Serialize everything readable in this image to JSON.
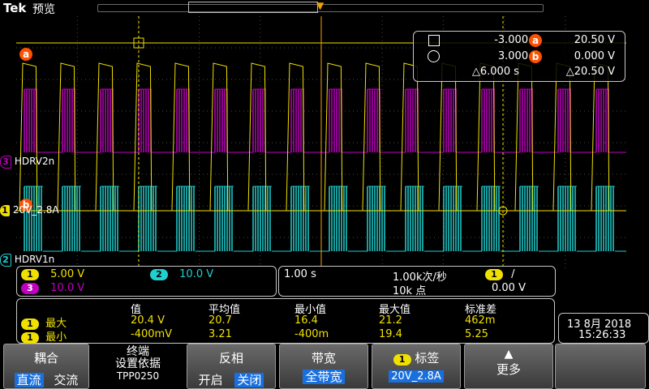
{
  "header": {
    "brand": "Tek",
    "mode": "预览"
  },
  "colors": {
    "ch1": "#f0e000",
    "ch2": "#20d0d0",
    "ch3": "#c000c0",
    "cursor": "#ff5000",
    "trigger": "#f0a000"
  },
  "channels": {
    "ch3_label": "HDRV2n",
    "ch1_label": "20V_2.8A",
    "ch2_label": "HDRV1n",
    "ch3_num": "3",
    "ch1_num": "1",
    "ch2_num": "2"
  },
  "cursors": {
    "a_letter": "a",
    "b_letter": "b",
    "t1": "-3.000 s",
    "t2": "3.000 s",
    "dt": "△6.000 s",
    "va": "20.50 V",
    "vb": "0.000 V",
    "dv": "△20.50 V"
  },
  "vertical": {
    "ch1_num": "1",
    "ch1_scale": "5.00 V",
    "ch2_num": "2",
    "ch2_scale": "10.0 V",
    "ch3_num": "3",
    "ch3_scale": "10.0 V"
  },
  "acquisition": {
    "timebase": "1.00 s",
    "rate": "1.00k次/秒",
    "points": "10k 点",
    "trig_ch": "1",
    "trig_slope": "/",
    "trig_level": "0.00 V"
  },
  "measurements": {
    "headers": [
      "值",
      "平均值",
      "最小值",
      "最大值",
      "标准差"
    ],
    "rows": [
      {
        "ch": "1",
        "name": "最大",
        "values": [
          "20.4 V",
          "20.7",
          "16.4",
          "21.2",
          "462m"
        ]
      },
      {
        "ch": "1",
        "name": "最小",
        "values": [
          "-400mV",
          "3.21",
          "-400m",
          "19.4",
          "5.25"
        ]
      }
    ]
  },
  "datetime": {
    "date": "13 8月 2018",
    "time": "15:26:33"
  },
  "softkeys": {
    "coupling": {
      "title": "耦合",
      "opt1": "直流",
      "opt2": "交流"
    },
    "termination": {
      "title_line1": "终端",
      "title_line2": "设置依据",
      "value": "TPP0250"
    },
    "invert": {
      "title": "反相",
      "opt1": "开启",
      "opt2": "关闭"
    },
    "bandwidth": {
      "title": "带宽",
      "value": "全带宽"
    },
    "label": {
      "num": "1",
      "title": "标签",
      "value": "20V_2.8A"
    },
    "more": {
      "title": "更多"
    }
  }
}
